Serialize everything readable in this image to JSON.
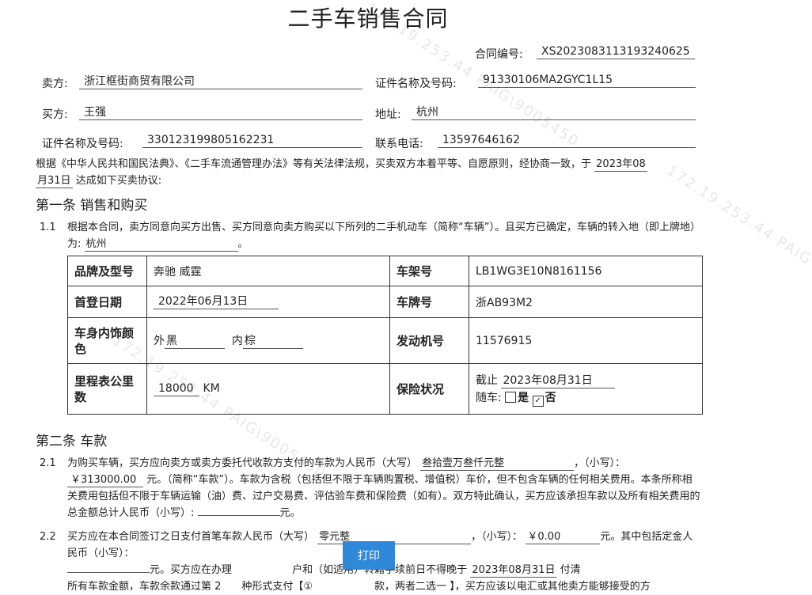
{
  "title": "二手车销售合同",
  "contract_no": {
    "label": "合同编号:",
    "value": "XS2023083113193240625"
  },
  "seller": {
    "label": "卖方:",
    "value": "浙江框街商贸有限公司"
  },
  "seller_id": {
    "label": "证件名称及号码:",
    "value": "91330106MA2GYC1L15"
  },
  "buyer": {
    "label": "买方:",
    "value": "王强"
  },
  "address": {
    "label": "地址:",
    "value": "杭州"
  },
  "buyer_id": {
    "label": "证件名称及号码:",
    "value": "330123199805162231"
  },
  "phone": {
    "label": "联系电话:",
    "value": "13597646162"
  },
  "intro": {
    "text": "根据《中华人民共和国民法典》、《二手车流通管理办法》等有关法律法规，买卖双方本着平等、自愿原则，经协商一致，于",
    "date_part1": "2023年08",
    "date_part2": "月31日",
    "text2": "达成如下买卖协议:"
  },
  "section1": {
    "title": "第一条 销售和购买",
    "clause_no": "1.1",
    "text": "根据本合同，卖方同意向买方出售、买方同意向卖方购买以下所列的二手机动车（简称“车辆”）。且买方已确定，车辆的转入地（即上牌地）为:",
    "transfer_place": "杭州",
    "end": "。"
  },
  "vehicle": {
    "brand_label": "品牌及型号",
    "brand": "奔驰 威霆",
    "vin_label": "车架号",
    "vin": "LB1WG3E10N8161156",
    "first_reg_label": "首登日期",
    "first_reg": "2022年06月13日",
    "plate_label": "车牌号",
    "plate": "浙AB93M2",
    "color_label": "车身内饰颜色",
    "exterior_label": "外",
    "exterior": "黑",
    "interior_label": "内",
    "interior": "棕",
    "engine_label": "发动机号",
    "engine": "11576915",
    "mileage_label": "里程表公里数",
    "mileage": "18000",
    "mileage_unit": "KM",
    "insurance_label": "保险状况",
    "insurance_until_label": "截止",
    "insurance_until": "2023年08月31日",
    "with_car_label": "随车:",
    "yes_label": "是",
    "no_label": "否",
    "yes_checked": false,
    "no_checked": true
  },
  "section2": {
    "title": "第二条 车款",
    "c21_no": "2.1",
    "c21_a": "为购买车辆，买方应向卖方或卖方委托代收款方支付的车款为人民币（大写）",
    "price_upper": "叁拾壹万叁仟元整",
    "c21_b": "，（小写）：",
    "price_lower": "￥313000.00",
    "c21_c": "元。（简称“车款”）。车款为含税（包括但不限于车辆购置税、增值税）车价，但不包含车辆的任何相关费用。本条所称相关费用包括但不限于车辆运输（油）费、过户交易费、评估验车费和保险费（如有）。双方特此确认，买方应该承担车款以及所有相关费用的总金额总计人民币（小写）:",
    "c21_d": "元。",
    "c22_no": "2.2",
    "c22_a": "买方应在本合同签订之日支付首笔车款人民币（大写）",
    "first_upper": "零元整",
    "c22_b": "，（小写）：",
    "first_lower": "￥0.00",
    "c22_c": "元。其中包括定金人民币（小写）：",
    "c22_d": "元。买方应在办理",
    "c22_e": "户和（如适用）转籍手续前日不得晚于",
    "deadline": "2023年08月31日",
    "c22_f": "付清",
    "c22_line3": "所有车款金额，车款余款通过第 2　　种形式支付【①　　　　　　款，两者二选一 】，买方应该以电汇或其他卖方能够接受的方"
  },
  "print_button": "打印",
  "watermark": [
    "172.19.253.44 PAIG\\9005450",
    "172.19.253.44 PAIG\\9005450",
    "172.19.253.44 PAIG"
  ]
}
